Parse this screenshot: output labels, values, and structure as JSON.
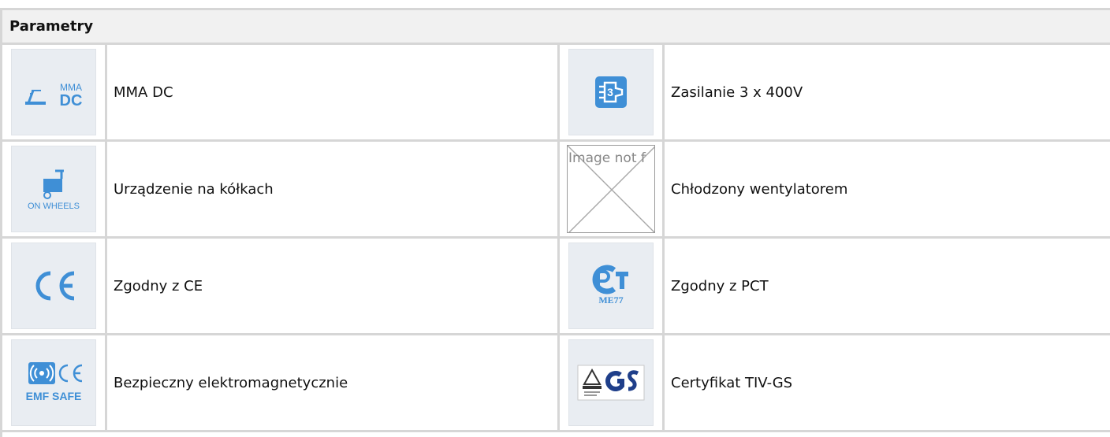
{
  "header": {
    "title": "Parametry"
  },
  "params": [
    {
      "label": "MMA DC",
      "icon": "mma-dc-icon"
    },
    {
      "label": "Zasilanie 3 x 400V",
      "icon": "power-plug-icon"
    },
    {
      "label": "Urządzenie na kółkach",
      "icon": "on-wheels-icon"
    },
    {
      "label": "Chłodzony wentylatorem",
      "icon": "broken-image-icon",
      "alt": "Image not f"
    },
    {
      "label": "Zgodny z CE",
      "icon": "ce-mark-icon"
    },
    {
      "label": "Zgodny z PCT",
      "icon": "pct-mark-icon"
    },
    {
      "label": "Bezpieczny elektromagnetycznie",
      "icon": "emf-safe-icon"
    },
    {
      "label": "Certyfikat TIV-GS",
      "icon": "gs-cert-icon"
    }
  ],
  "icon_text": {
    "mma": "MMA",
    "dc": "DC",
    "three": "3",
    "on_wheels": "ON WHEELS",
    "pct_code": "ME77",
    "emf_safe": "EMF SAFE"
  },
  "colors": {
    "icon_blue": "#3f8fd6",
    "icon_bg": "#e9edf2",
    "border": "#d6d6d6",
    "header_bg": "#f1f1f1"
  }
}
